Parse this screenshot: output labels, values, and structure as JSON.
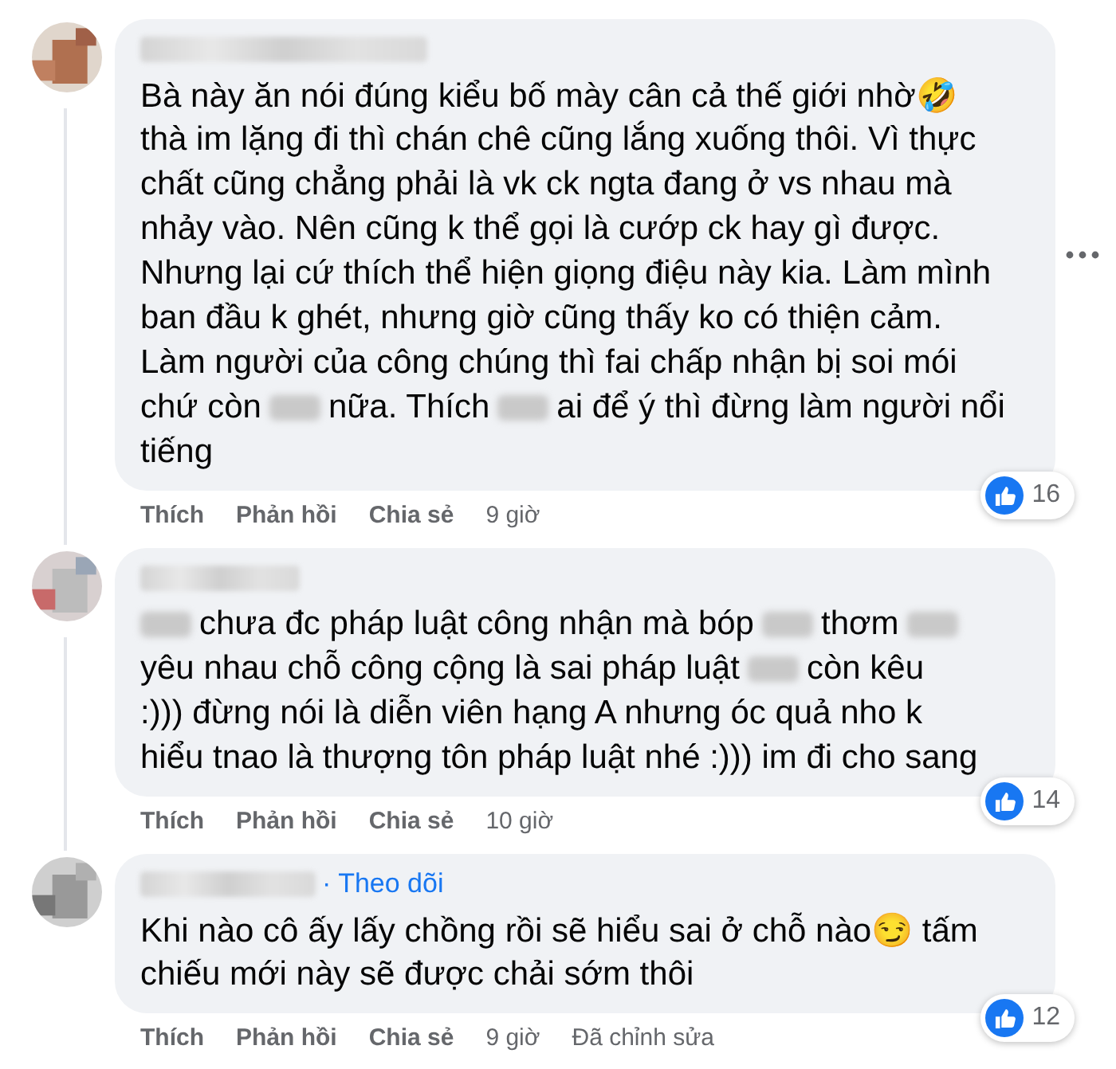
{
  "comments": [
    {
      "lines": [
        [
          {
            "kind": "text",
            "text": "Bà này ăn nói đúng kiểu bố mày cân cả thế giới nhờ🤣"
          }
        ],
        [
          {
            "kind": "text",
            "text": "thà im lặng đi thì chán chê cũng lắng xuống thôi. Vì thực"
          }
        ],
        [
          {
            "kind": "text",
            "text": "chất cũng chẳng phải là vk ck ngta đang ở vs nhau mà"
          }
        ],
        [
          {
            "kind": "text",
            "text": "nhảy vào. Nên cũng k thể gọi là cướp ck hay gì được."
          }
        ],
        [
          {
            "kind": "text",
            "text": "Nhưng lại cứ thích thể hiện giọng điệu này kia. Làm mình"
          }
        ],
        [
          {
            "kind": "text",
            "text": "ban đầu k ghét, nhưng giờ cũng thấy ko có thiện cảm."
          }
        ],
        [
          {
            "kind": "text",
            "text": "Làm người của công chúng thì fai chấp nhận bị soi mói"
          }
        ],
        [
          {
            "kind": "text",
            "text": "chứ còn"
          },
          {
            "kind": "blur"
          },
          {
            "kind": "text",
            "text": "nữa. Thích"
          },
          {
            "kind": "blur"
          },
          {
            "kind": "text",
            "text": "ai để ý thì đừng làm người nổi"
          }
        ],
        [
          {
            "kind": "text",
            "text": "tiếng"
          }
        ]
      ],
      "more": true,
      "reactions": "16",
      "actions": [
        "Thích",
        "Phản hồi",
        "Chia sẻ"
      ],
      "time": "9 giờ"
    },
    {
      "lines": [
        [
          {
            "kind": "blur"
          },
          {
            "kind": "text",
            "text": "chưa đc pháp luật công nhận mà bóp"
          },
          {
            "kind": "blur"
          },
          {
            "kind": "text",
            "text": "thơm"
          },
          {
            "kind": "blur"
          }
        ],
        [
          {
            "kind": "text",
            "text": "yêu nhau chỗ công cộng là sai pháp luật"
          },
          {
            "kind": "blur"
          },
          {
            "kind": "text",
            "text": "còn kêu"
          }
        ],
        [
          {
            "kind": "text",
            "text": ":))) đừng nói là diễn viên hạng A nhưng óc quả nho k"
          }
        ],
        [
          {
            "kind": "text",
            "text": "hiểu tnao là thượng tôn pháp luật nhé :))) im đi cho sang"
          }
        ]
      ],
      "more": false,
      "reactions": "14",
      "actions": [
        "Thích",
        "Phản hồi",
        "Chia sẻ"
      ],
      "time": "10 giờ"
    },
    {
      "follow": "· Theo dõi",
      "lines": [
        [
          {
            "kind": "text",
            "text": "Khi nào cô ấy lấy chồng rồi sẽ hiểu sai ở chỗ nào😏 tấm"
          }
        ],
        [
          {
            "kind": "text",
            "text": "chiếu mới này sẽ được chải sớm thôi"
          }
        ]
      ],
      "more": false,
      "reactions": "12",
      "actions": [
        "Thích",
        "Phản hồi",
        "Chia sẻ"
      ],
      "time": "9 giờ",
      "edited": "Đã chỉnh sửa"
    }
  ]
}
